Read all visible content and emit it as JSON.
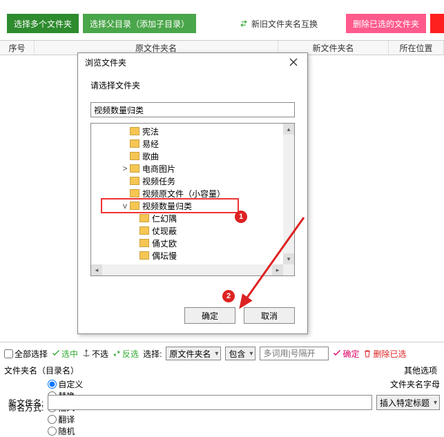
{
  "toolbar": {
    "select_multi": "选择多个文件夹",
    "select_parent": "选择父目录（添加子目录）",
    "swap": "新旧文件夹名互换",
    "delete_selected": "删除已选的文件夹"
  },
  "columns": {
    "seq": "序号",
    "orig": "原文件夹名",
    "newname": "新文件夹名",
    "loc": "所在位置"
  },
  "modal": {
    "title": "浏览文件夹",
    "prompt": "请选择文件夹",
    "path_value": "视频数量归类",
    "tree": [
      {
        "indent": 3,
        "twisty": "",
        "label": "宪法"
      },
      {
        "indent": 3,
        "twisty": "",
        "label": "易经"
      },
      {
        "indent": 3,
        "twisty": "",
        "label": "歌曲"
      },
      {
        "indent": 3,
        "twisty": ">",
        "label": "电商图片"
      },
      {
        "indent": 3,
        "twisty": "",
        "label": "视频任务"
      },
      {
        "indent": 3,
        "twisty": "",
        "label": "视频原文件（小容量）"
      },
      {
        "indent": 3,
        "twisty": "v",
        "label": "视频数量归类",
        "selected": true
      },
      {
        "indent": 4,
        "twisty": "",
        "label": "仁幻隅"
      },
      {
        "indent": 4,
        "twisty": "",
        "label": "仗现蔽"
      },
      {
        "indent": 4,
        "twisty": "",
        "label": "俑丈欧"
      },
      {
        "indent": 4,
        "twisty": "",
        "label": "偶坛慢"
      }
    ],
    "ok": "确定",
    "cancel": "取消"
  },
  "annotation": {
    "n1": "1",
    "n2": "2"
  },
  "bottom": {
    "all_select": "全部选择",
    "select_on": "选中",
    "select_off": "不选",
    "invert": "反选",
    "select_label": "选择:",
    "select_field": "原文件夹名",
    "contains": "包含",
    "keywords_placeholder": "多词用|号隔开",
    "confirm": "确定",
    "delete_sel": "删除已选",
    "panel_title": "文件夹名（目录名）",
    "other_options": "其他选项",
    "naming_label": "命名方式:",
    "naming_opts": [
      "自定义",
      "替换",
      "插入",
      "翻译",
      "随机"
    ],
    "folder_name_hint": "文件夹名字母",
    "newname_label": "新文件名:",
    "insert_title": "插入特定标题"
  },
  "colors": {
    "green_dark": "#2e8b2e",
    "green": "#4aa64a",
    "pink": "#ff5a8c",
    "red": "#ff1f1f",
    "annot_red": "#d22"
  }
}
